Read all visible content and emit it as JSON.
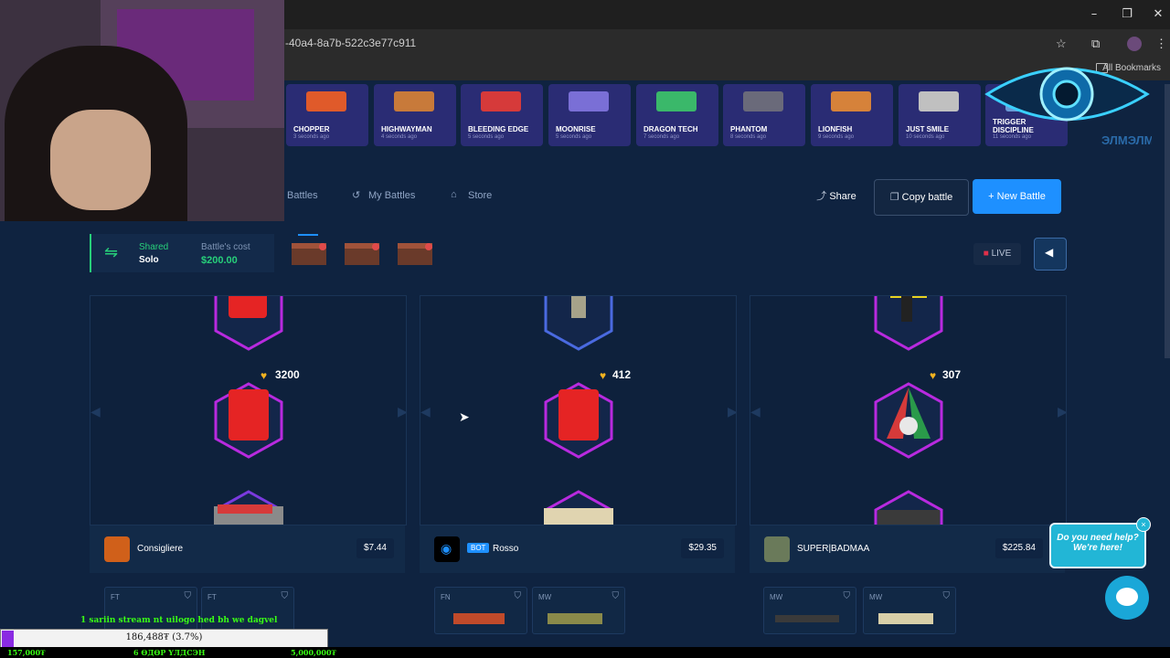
{
  "browser": {
    "url": "-40a4-8a7b-522c3e77c911",
    "bookmarks_label": "All Bookmarks"
  },
  "feed": [
    {
      "name": "CHOPPER",
      "time": "3 seconds ago",
      "color": "#e05a2a"
    },
    {
      "name": "HIGHWAYMAN",
      "time": "4 seconds ago",
      "color": "#c87a3a"
    },
    {
      "name": "BLEEDING EDGE",
      "time": "5 seconds ago",
      "color": "#d63a3a"
    },
    {
      "name": "MOONRISE",
      "time": "5 seconds ago",
      "color": "#7a6fd6"
    },
    {
      "name": "DRAGON TECH",
      "time": "7 seconds ago",
      "color": "#3ab86a"
    },
    {
      "name": "PHANTOM",
      "time": "8 seconds ago",
      "color": "#6a6a7a"
    },
    {
      "name": "LIONFISH",
      "time": "9 seconds ago",
      "color": "#d6823a"
    },
    {
      "name": "JUST SMILE",
      "time": "10 seconds ago",
      "color": "#c0c0c0"
    },
    {
      "name": "TRIGGER DISCIPLINE",
      "time": "11 seconds ago",
      "color": "#6a9ad6"
    }
  ],
  "nav": {
    "battles": "Battles",
    "my_battles": "My Battles",
    "store": "Store",
    "share": "Share",
    "copy_battle": "Copy battle",
    "new_battle": "New Battle"
  },
  "battle_info": {
    "mode": "Shared",
    "type": "Solo",
    "cost_label": "Battle's cost",
    "cost": "$200.00",
    "live": "LIVE"
  },
  "columns": [
    {
      "score": "3200",
      "player": "Consigliere",
      "value": "$7.44",
      "bot": "",
      "grades": [
        "FT",
        "FT"
      ]
    },
    {
      "score": "412",
      "player": "Rosso",
      "value": "$29.35",
      "bot": "BOT",
      "grades": [
        "FN",
        "MW"
      ]
    },
    {
      "score": "307",
      "player": "SUPER|BADMAA",
      "value": "$225.84",
      "bot": "",
      "grades": [
        "MW",
        "MW"
      ]
    }
  ],
  "help": {
    "line1": "Do you need help?",
    "line2": "We're here!"
  },
  "stream": {
    "ticker": "1 sariin stream nt uilogo hed bh we dagvel",
    "progress_text": "186,488₮ (3.7%)",
    "progress_fraction": 0.037,
    "left": "157,000₮",
    "middle": "6 ӨДӨР ҮЛДСЭН",
    "right": "5,000,000₮"
  },
  "watermark": "ЭЛМЭЛМИЙ"
}
